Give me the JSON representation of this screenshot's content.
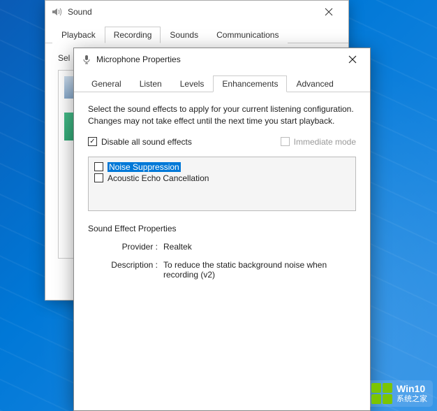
{
  "sound_window": {
    "title": "Sound",
    "tabs": [
      "Playback",
      "Recording",
      "Sounds",
      "Communications"
    ],
    "active_tab_index": 1,
    "body_text_visible": "Sel"
  },
  "mic_window": {
    "title": "Microphone Properties",
    "tabs": [
      "General",
      "Listen",
      "Levels",
      "Enhancements",
      "Advanced"
    ],
    "active_tab_index": 3,
    "description": "Select the sound effects to apply for your current listening configuration. Changes may not take effect until the next time you start playback.",
    "disable_all": {
      "label": "Disable all sound effects",
      "checked": true
    },
    "immediate_mode": {
      "label": "Immediate mode",
      "checked": false
    },
    "effects": [
      {
        "label": "Noise Suppression",
        "checked": false,
        "selected": true
      },
      {
        "label": "Acoustic Echo Cancellation",
        "checked": false,
        "selected": false
      }
    ],
    "props": {
      "title": "Sound Effect Properties",
      "provider_label": "Provider :",
      "provider_value": "Realtek",
      "description_label": "Description :",
      "description_value": "To reduce the static background noise when recording (v2)"
    }
  },
  "watermark": {
    "line1": "Win10",
    "line2": "系统之家"
  }
}
